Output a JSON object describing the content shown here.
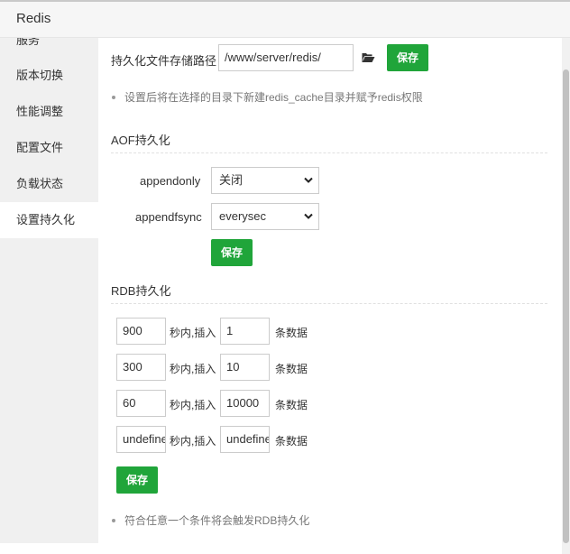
{
  "window": {
    "title": "Redis"
  },
  "sidebar": {
    "items": [
      {
        "label": "服务"
      },
      {
        "label": "版本切换"
      },
      {
        "label": "性能调整"
      },
      {
        "label": "配置文件"
      },
      {
        "label": "负载状态"
      },
      {
        "label": "设置持久化"
      }
    ],
    "active_index": 5
  },
  "persist_path": {
    "label": "持久化文件存储路径",
    "value": "/www/server/redis/",
    "icon": "folder-open-icon",
    "save_label": "保存",
    "hint": "设置后将在选择的目录下新建redis_cache目录并赋予redis权限"
  },
  "aof": {
    "title": "AOF持久化",
    "appendonly": {
      "label": "appendonly",
      "value": "关闭"
    },
    "appendfsync": {
      "label": "appendfsync",
      "value": "everysec"
    },
    "save_label": "保存"
  },
  "rdb": {
    "title": "RDB持久化",
    "sec_suffix": "秒内,插入",
    "count_suffix": "条数据",
    "rows": [
      {
        "seconds": "900",
        "changes": "1"
      },
      {
        "seconds": "300",
        "changes": "10"
      },
      {
        "seconds": "60",
        "changes": "10000"
      },
      {
        "seconds": "undefined",
        "changes": "undefined"
      }
    ],
    "save_label": "保存",
    "hint": "符合任意一个条件将会触发RDB持久化"
  },
  "colors": {
    "accent": "#20a53a",
    "sidebar_bg": "#f0f0f0"
  }
}
